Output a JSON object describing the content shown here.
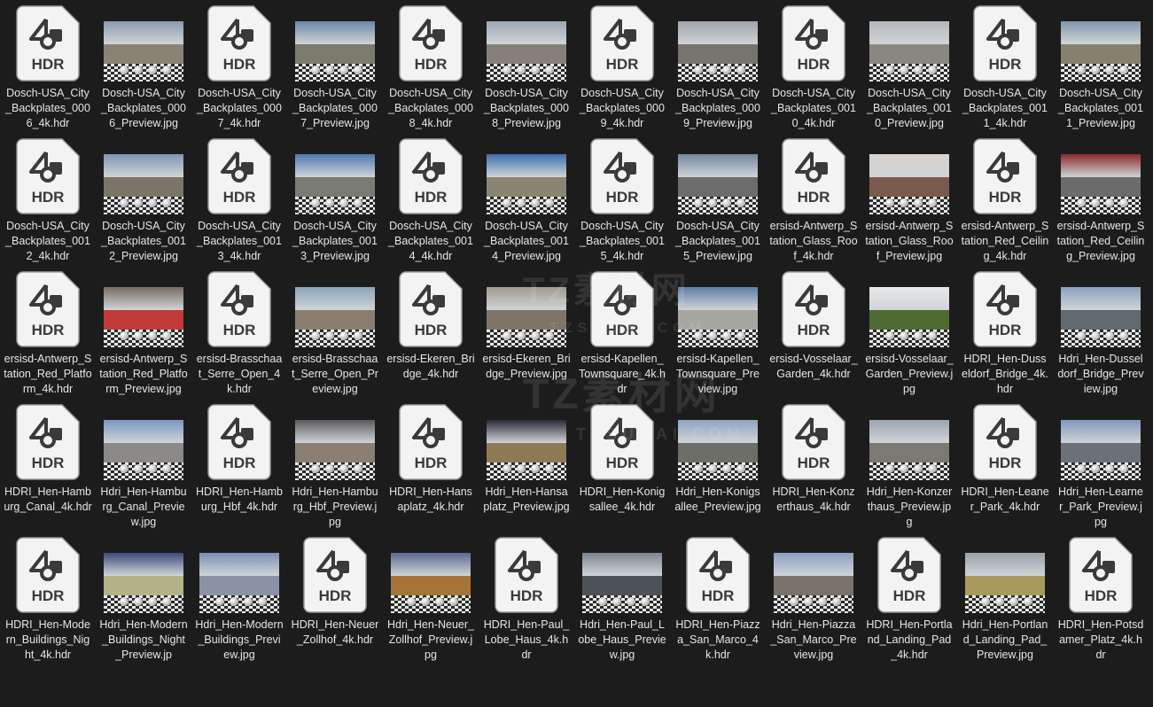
{
  "hdr_badge": "HDR",
  "watermark": {
    "brand": "TZ素材网",
    "url": "TZSUCAI.COM"
  },
  "files": [
    {
      "name": "Dosch-USA_City_Backplates_0006_4k.hdr",
      "type": "hdr"
    },
    {
      "name": "Dosch-USA_City_Backplates_0006_Preview.jpg",
      "type": "jpg",
      "sky": "#8a9bb0",
      "ground": "#8b8275"
    },
    {
      "name": "Dosch-USA_City_Backplates_0007_4k.hdr",
      "type": "hdr"
    },
    {
      "name": "Dosch-USA_City_Backplates_0007_Preview.jpg",
      "type": "jpg",
      "sky": "#6d87a8",
      "ground": "#7b7b6e"
    },
    {
      "name": "Dosch-USA_City_Backplates_0008_4k.hdr",
      "type": "hdr"
    },
    {
      "name": "Dosch-USA_City_Backplates_0008_Preview.jpg",
      "type": "jpg",
      "sky": "#9aa7b5",
      "ground": "#85817a"
    },
    {
      "name": "Dosch-USA_City_Backplates_0009_4k.hdr",
      "type": "hdr"
    },
    {
      "name": "Dosch-USA_City_Backplates_0009_Preview.jpg",
      "type": "jpg",
      "sky": "#9da3aa",
      "ground": "#77736d"
    },
    {
      "name": "Dosch-USA_City_Backplates_0010_4k.hdr",
      "type": "hdr"
    },
    {
      "name": "Dosch-USA_City_Backplates_0010_Preview.jpg",
      "type": "jpg",
      "sky": "#b5b8bb",
      "ground": "#8a8782"
    },
    {
      "name": "Dosch-USA_City_Backplates_0011_4k.hdr",
      "type": "hdr"
    },
    {
      "name": "Dosch-USA_City_Backplates_0011_Preview.jpg",
      "type": "jpg",
      "sky": "#8296ad",
      "ground": "#86806f"
    },
    {
      "name": "Dosch-USA_City_Backplates_0012_4k.hdr",
      "type": "hdr"
    },
    {
      "name": "Dosch-USA_City_Backplates_0012_Preview.jpg",
      "type": "jpg",
      "sky": "#7e95b3",
      "ground": "#7a7566"
    },
    {
      "name": "Dosch-USA_City_Backplates_0013_4k.hdr",
      "type": "hdr"
    },
    {
      "name": "Dosch-USA_City_Backplates_0013_Preview.jpg",
      "type": "jpg",
      "sky": "#4f79ad",
      "ground": "#7a7a72"
    },
    {
      "name": "Dosch-USA_City_Backplates_0014_4k.hdr",
      "type": "hdr"
    },
    {
      "name": "Dosch-USA_City_Backplates_0014_Preview.jpg",
      "type": "jpg",
      "sky": "#3c6fb0",
      "ground": "#8a8573"
    },
    {
      "name": "Dosch-USA_City_Backplates_0015_4k.hdr",
      "type": "hdr"
    },
    {
      "name": "Dosch-USA_City_Backplates_0015_Preview.jpg",
      "type": "jpg",
      "sky": "#7388a3",
      "ground": "#6c6c6a"
    },
    {
      "name": "ersisd-Antwerp_Station_Glass_Roof_4k.hdr",
      "type": "hdr"
    },
    {
      "name": "ersisd-Antwerp_Station_Glass_Roof_Preview.jpg",
      "type": "jpg",
      "sky": "#d8d2cc",
      "ground": "#7b5a4d"
    },
    {
      "name": "ersisd-Antwerp_Station_Red_Ceiling_4k.hdr",
      "type": "hdr"
    },
    {
      "name": "ersisd-Antwerp_Station_Red_Ceiling_Preview.jpg",
      "type": "jpg",
      "sky": "#8a2a2a",
      "ground": "#6b6b6b"
    },
    {
      "name": "ersisd-Antwerp_Station_Red_Platform_4k.hdr",
      "type": "hdr"
    },
    {
      "name": "ersisd-Antwerp_Station_Red_Platform_Preview.jpg",
      "type": "jpg",
      "sky": "#7a6a62",
      "ground": "#c23a3a"
    },
    {
      "name": "ersisd-Brasschaat_Serre_Open_4k.hdr",
      "type": "hdr"
    },
    {
      "name": "ersisd-Brasschaat_Serre_Open_Preview.jpg",
      "type": "jpg",
      "sky": "#8aa4b8",
      "ground": "#8a7f6f"
    },
    {
      "name": "ersisd-Ekeren_Bridge_4k.hdr",
      "type": "hdr"
    },
    {
      "name": "ersisd-Ekeren_Bridge_Preview.jpg",
      "type": "jpg",
      "sky": "#a09a8e",
      "ground": "#7e7468"
    },
    {
      "name": "ersisd-Kapellen_Townsquare_4k.hdr",
      "type": "hdr"
    },
    {
      "name": "ersisd-Kapellen_Townsquare_Preview.jpg",
      "type": "jpg",
      "sky": "#5f7fa6",
      "ground": "#a8a6a0"
    },
    {
      "name": "ersisd-Vosselaar_Garden_4k.hdr",
      "type": "hdr"
    },
    {
      "name": "ersisd-Vosselaar_Garden_Preview.jpg",
      "type": "jpg",
      "sky": "#e8e8e8",
      "ground": "#4d6b32"
    },
    {
      "name": "HDRI_Hen-Dusseldorf_Bridge_4k.hdr",
      "type": "hdr"
    },
    {
      "name": "Hdri_Hen-Dusseldorf_Bridge_Preview.jpg",
      "type": "jpg",
      "sky": "#8aa2bd",
      "ground": "#5e6a70"
    },
    {
      "name": "HDRI_Hen-Hamburg_Canal_4k.hdr",
      "type": "hdr"
    },
    {
      "name": "Hdri_Hen-Hamburg_Canal_Preview.jpg",
      "type": "jpg",
      "sky": "#7b95c2",
      "ground": "#8c8a88"
    },
    {
      "name": "HDRI_Hen-Hamburg_Hbf_4k.hdr",
      "type": "hdr"
    },
    {
      "name": "Hdri_Hen-Hamburg_Hbf_Preview.jpg",
      "type": "jpg",
      "sky": "#5a5a5e",
      "ground": "#8a7f72"
    },
    {
      "name": "HDRI_Hen-Hansaplatz_4k.hdr",
      "type": "hdr"
    },
    {
      "name": "Hdri_Hen-Hansaplatz_Preview.jpg",
      "type": "jpg",
      "sky": "#2a2a3a",
      "ground": "#8d7a55"
    },
    {
      "name": "HDRI_Hen-Konigsallee_4k.hdr",
      "type": "hdr"
    },
    {
      "name": "Hdri_Hen-Konigsallee_Preview.jpg",
      "type": "jpg",
      "sky": "#8ea3bf",
      "ground": "#6e6e68"
    },
    {
      "name": "HDRI_Hen-Konzerthaus_4k.hdr",
      "type": "hdr"
    },
    {
      "name": "Hdri_Hen-Konzerthaus_Preview.jpg",
      "type": "jpg",
      "sky": "#9aa4b0",
      "ground": "#7c7872"
    },
    {
      "name": "HDRI_Hen-Leaner_Park_4k.hdr",
      "type": "hdr"
    },
    {
      "name": "Hdri_Hen-Learner_Park_Preview.jpg",
      "type": "jpg",
      "sky": "#7f97bb",
      "ground": "#6c7078"
    },
    {
      "name": "HDRI_Hen-Modern_Buildings_Night_4k.hdr",
      "type": "hdr"
    },
    {
      "name": "Hdri_Hen-Modern_Buildings_Night_Preview.jp",
      "type": "jpg",
      "sky": "#3a4a7a",
      "ground": "#b5b28a"
    },
    {
      "name": "Hdri_Hen-Modern_Buildings_Preview.jpg",
      "type": "jpg",
      "sky": "#7a8fb5",
      "ground": "#8a92a6"
    },
    {
      "name": "HDRI_Hen-Neuer_Zollhof_4k.hdr",
      "type": "hdr"
    },
    {
      "name": "Hdri_Hen-Neuer_Zollhof_Preview.jpg",
      "type": "jpg",
      "sky": "#5a6a90",
      "ground": "#a47438"
    },
    {
      "name": "HDRI_Hen-Paul_Lobe_Haus_4k.hdr",
      "type": "hdr"
    },
    {
      "name": "Hdri_Hen-Paul_Lobe_Haus_Preview.jpg",
      "type": "jpg",
      "sky": "#7c8590",
      "ground": "#4c5258"
    },
    {
      "name": "HDRI_Hen-Piazza_San_Marco_4k.hdr",
      "type": "hdr"
    },
    {
      "name": "Hdri_Hen-Piazza_San_Marco_Preview.jpg",
      "type": "jpg",
      "sky": "#8aa0c0",
      "ground": "#7a726a"
    },
    {
      "name": "HDRI_Hen-Portland_Landing_Pad_4k.hdr",
      "type": "hdr"
    },
    {
      "name": "Hdri_Hen-Portland_Landing_Pad_Preview.jpg",
      "type": "jpg",
      "sky": "#9aa2aa",
      "ground": "#a89a5a"
    },
    {
      "name": "HDRI_Hen-Potsdamer_Platz_4k.hdr",
      "type": "hdr"
    }
  ]
}
